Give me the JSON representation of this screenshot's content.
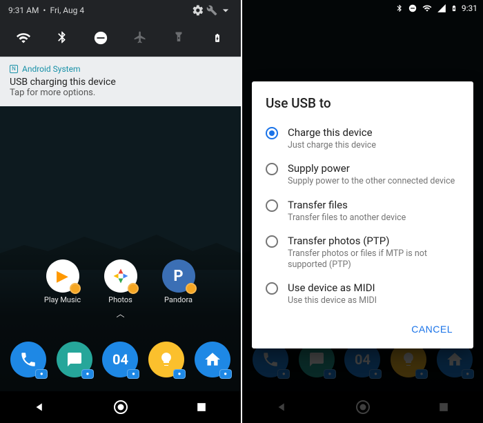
{
  "left": {
    "status": {
      "time": "9:31 AM",
      "date": "Fri, Aug 4"
    },
    "notification": {
      "app": "Android System",
      "title": "USB charging this device",
      "subtitle": "Tap for more options."
    },
    "apps": [
      {
        "name": "Play Music"
      },
      {
        "name": "Photos"
      },
      {
        "name": "Pandora"
      }
    ],
    "dock_center": "04"
  },
  "right": {
    "status_time": "9:31",
    "dialog": {
      "title": "Use USB to",
      "options": [
        {
          "label": "Charge this device",
          "desc": "Just charge this device",
          "selected": true
        },
        {
          "label": "Supply power",
          "desc": "Supply power to the other connected device",
          "selected": false
        },
        {
          "label": "Transfer files",
          "desc": "Transfer files to another device",
          "selected": false
        },
        {
          "label": "Transfer photos (PTP)",
          "desc": "Transfer photos or files if MTP is not supported (PTP)",
          "selected": false
        },
        {
          "label": "Use device as MIDI",
          "desc": "Use this device as MIDI",
          "selected": false
        }
      ],
      "cancel": "CANCEL"
    },
    "dock_center": "04"
  }
}
